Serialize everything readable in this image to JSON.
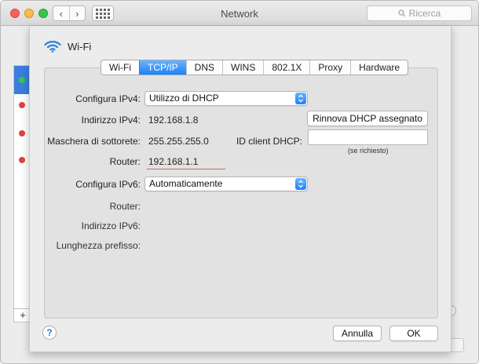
{
  "window": {
    "title": "Network",
    "search_placeholder": "Ricerca",
    "nav_back": "‹",
    "nav_forward": "›",
    "add_label": "+"
  },
  "sheet": {
    "interface_name": "Wi-Fi",
    "tabs": [
      {
        "label": "Wi-Fi",
        "active": false
      },
      {
        "label": "TCP/IP",
        "active": true
      },
      {
        "label": "DNS",
        "active": false
      },
      {
        "label": "WINS",
        "active": false
      },
      {
        "label": "802.1X",
        "active": false
      },
      {
        "label": "Proxy",
        "active": false
      },
      {
        "label": "Hardware",
        "active": false
      }
    ],
    "ipv4": {
      "configure_label": "Configura IPv4:",
      "configure_value": "Utilizzo di DHCP",
      "address_label": "Indirizzo IPv4:",
      "address_value": "192.168.1.8",
      "renew_button": "Rinnova DHCP assegnato",
      "subnet_label": "Maschera di sottorete:",
      "subnet_value": "255.255.255.0",
      "dhcp_client_label": "ID client DHCP:",
      "dhcp_client_value": "",
      "dhcp_client_hint": "(se richiesto)",
      "router_label": "Router:",
      "router_value": "192.168.1.1"
    },
    "ipv6": {
      "configure_label": "Configura IPv6:",
      "configure_value": "Automaticamente",
      "router_label": "Router:",
      "address_label": "Indirizzo IPv6:",
      "prefix_label": "Lunghezza prefisso:"
    },
    "help_label": "?",
    "cancel_button": "Annulla",
    "ok_button": "OK"
  },
  "colors": {
    "accent": "#1a82fb",
    "status_green": "#34c84a",
    "status_red": "#e0443e",
    "underline": "#e06060"
  }
}
